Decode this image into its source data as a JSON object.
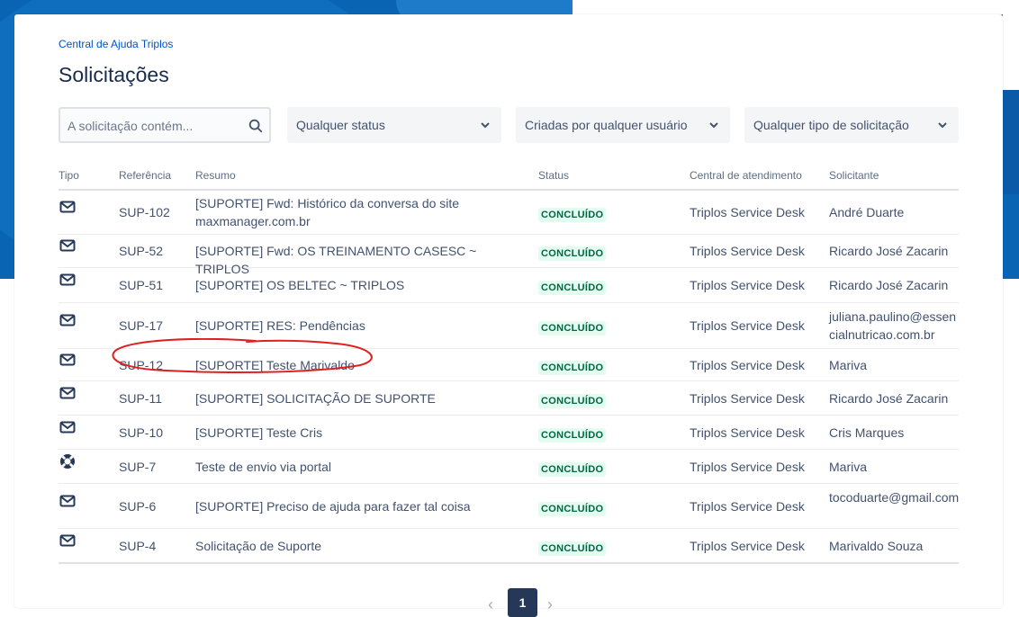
{
  "colors": {
    "brand_blue": "#0a64b4",
    "link": "#0052cc",
    "lozenge_bg": "#e3fcef",
    "lozenge_text": "#006644",
    "annotation_red": "#e02020"
  },
  "header": {
    "breadcrumb": "Central de Ajuda Triplos",
    "title": "Solicitações"
  },
  "filters": {
    "search_placeholder": "A solicitação contém...",
    "status_label": "Qualquer status",
    "creator_label": "Criadas por qualquer usuário",
    "type_label": "Qualquer tipo de solicitação"
  },
  "table": {
    "columns": [
      "Tipo",
      "Referência",
      "Resumo",
      "Status",
      "Central de atendimento",
      "Solicitante"
    ],
    "rows": [
      {
        "icon": "mail-icon",
        "ref": "SUP-102",
        "summary": "[SUPORTE] Fwd: Histórico da conversa do site maxmanager.com.br",
        "status": "CONCLUÍDO",
        "desk": "Triplos Service Desk",
        "requester": "André Duarte"
      },
      {
        "icon": "mail-icon",
        "ref": "SUP-52",
        "summary": "[SUPORTE] Fwd: OS TREINAMENTO CASESC ~ TRIPLOS",
        "status": "CONCLUÍDO",
        "desk": "Triplos Service Desk",
        "requester": "Ricardo José Zacarin"
      },
      {
        "icon": "mail-icon",
        "ref": "SUP-51",
        "summary": "[SUPORTE] OS BELTEC ~ TRIPLOS",
        "status": "CONCLUÍDO",
        "desk": "Triplos Service Desk",
        "requester": "Ricardo José Zacarin"
      },
      {
        "icon": "mail-icon",
        "ref": "SUP-17",
        "summary": "[SUPORTE] RES: Pendências",
        "status": "CONCLUÍDO",
        "desk": "Triplos Service Desk",
        "requester": "juliana.paulino@essencialnutricao.com.br"
      },
      {
        "icon": "mail-icon",
        "ref": "SUP-12",
        "summary": "[SUPORTE] Teste Marivaldo",
        "status": "CONCLUÍDO",
        "desk": "Triplos Service Desk",
        "requester": "Mariva"
      },
      {
        "icon": "mail-icon",
        "ref": "SUP-11",
        "summary": "[SUPORTE] SOLICITAÇÃO DE SUPORTE",
        "status": "CONCLUÍDO",
        "desk": "Triplos Service Desk",
        "requester": "Ricardo José Zacarin"
      },
      {
        "icon": "mail-icon",
        "ref": "SUP-10",
        "summary": "[SUPORTE] Teste Cris",
        "status": "CONCLUÍDO",
        "desk": "Triplos Service Desk",
        "requester": "Cris Marques"
      },
      {
        "icon": "lifebuoy-icon",
        "ref": "SUP-7",
        "summary": "Teste de envio via portal",
        "status": "CONCLUÍDO",
        "desk": "Triplos Service Desk",
        "requester": "Mariva"
      },
      {
        "icon": "mail-icon",
        "ref": "SUP-6",
        "summary": "[SUPORTE] Preciso de ajuda para fazer tal coisa",
        "status": "CONCLUÍDO",
        "desk": "Triplos Service Desk",
        "requester": "tocoduarte@gmail.com"
      },
      {
        "icon": "mail-icon",
        "ref": "SUP-4",
        "summary": "Solicitação de Suporte",
        "status": "CONCLUÍDO",
        "desk": "Triplos Service Desk",
        "requester": "Marivaldo Souza"
      }
    ]
  },
  "pagination": {
    "prev": "‹",
    "current": "1",
    "next": "›"
  }
}
